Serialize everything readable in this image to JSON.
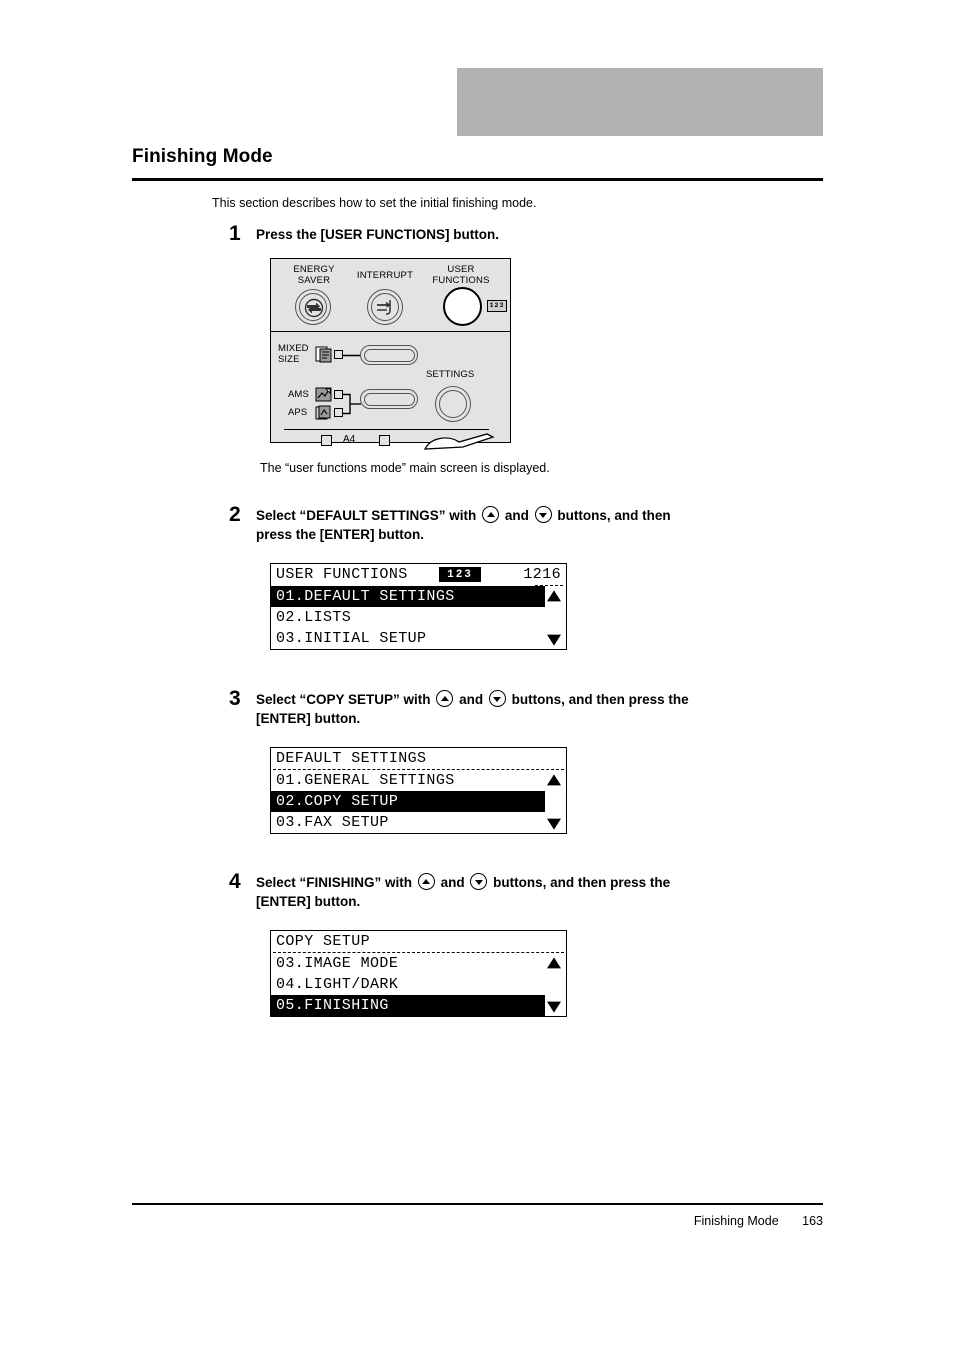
{
  "page": {
    "section_title": "Finishing Mode",
    "intro": "This section describes how to set the initial finishing mode.",
    "panel_caption": "The “user functions mode” main screen is displayed.",
    "footer_label": "Finishing Mode",
    "footer_page_number": "163",
    "header_band_color": "#b2b2b2"
  },
  "steps": [
    {
      "number": "1",
      "lines": [
        "Press the [USER FUNCTIONS] button."
      ]
    },
    {
      "number": "2",
      "line1_a": "Select “DEFAULT SETTINGS” with",
      "line1_b": "and",
      "line1_c": "buttons, and then",
      "line2": "press the [ENTER] button."
    },
    {
      "number": "3",
      "line1_a": "Select “COPY SETUP” with",
      "line1_b": "and",
      "line1_c": "buttons, and then press the",
      "line2": "[ENTER] button."
    },
    {
      "number": "4",
      "line1_a": "Select “FINISHING” with",
      "line1_b": "and",
      "line1_c": "buttons, and then press the",
      "line2": "[ENTER] button."
    }
  ],
  "control_panel": {
    "energy_saver_label_l1": "ENERGY",
    "energy_saver_label_l2": "SAVER",
    "interrupt_label": "INTERRUPT",
    "user_functions_label_l1": "USER",
    "user_functions_label_l2": "FUNCTIONS",
    "badge_123": "123",
    "mixed_size_label_l1": "MIXED",
    "mixed_size_label_l2": "SIZE",
    "ams_label": "AMS",
    "aps_label": "APS",
    "settings_label": "SETTINGS",
    "paper_size_label": "A4"
  },
  "screens": [
    {
      "title": "USER FUNCTIONS",
      "badge": "123",
      "counter": "1216",
      "separator": "short-dashed",
      "rows": [
        {
          "text": "01.DEFAULT SETTINGS",
          "selected": true,
          "arrow": "up"
        },
        {
          "text": "02.LISTS",
          "selected": false,
          "arrow": ""
        },
        {
          "text": "03.INITIAL SETUP",
          "selected": false,
          "arrow": "down"
        }
      ]
    },
    {
      "title": "DEFAULT SETTINGS",
      "badge": "",
      "counter": "",
      "separator": "full-dashed",
      "rows": [
        {
          "text": "01.GENERAL SETTINGS",
          "selected": false,
          "arrow": "up"
        },
        {
          "text": "02.COPY SETUP",
          "selected": true,
          "arrow": ""
        },
        {
          "text": "03.FAX SETUP",
          "selected": false,
          "arrow": "down"
        }
      ]
    },
    {
      "title": "COPY SETUP",
      "badge": "",
      "counter": "",
      "separator": "full-dashed",
      "rows": [
        {
          "text": "03.IMAGE MODE",
          "selected": false,
          "arrow": "up"
        },
        {
          "text": "04.LIGHT/DARK",
          "selected": false,
          "arrow": ""
        },
        {
          "text": "05.FINISHING",
          "selected": true,
          "arrow": "down"
        }
      ]
    }
  ]
}
